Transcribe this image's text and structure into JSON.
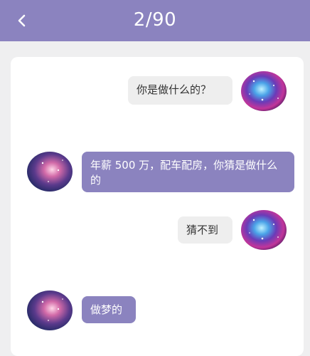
{
  "header": {
    "title": "2/90"
  },
  "icons": {
    "back": "chevron-left-icon",
    "avatar": "galaxy-avatar"
  },
  "colors": {
    "header_bg": "#8b83bf",
    "page_bg": "#efeff0",
    "bubble_self": "#eeeeee",
    "bubble_other": "#8b83bf"
  },
  "messages": [
    {
      "side": "right",
      "text": "你是做什么的？"
    },
    {
      "side": "left",
      "text": "年薪 500 万，配车配房，你猜是做什么的"
    },
    {
      "side": "right",
      "text": "猜不到"
    },
    {
      "side": "left",
      "text": "做梦的"
    }
  ]
}
